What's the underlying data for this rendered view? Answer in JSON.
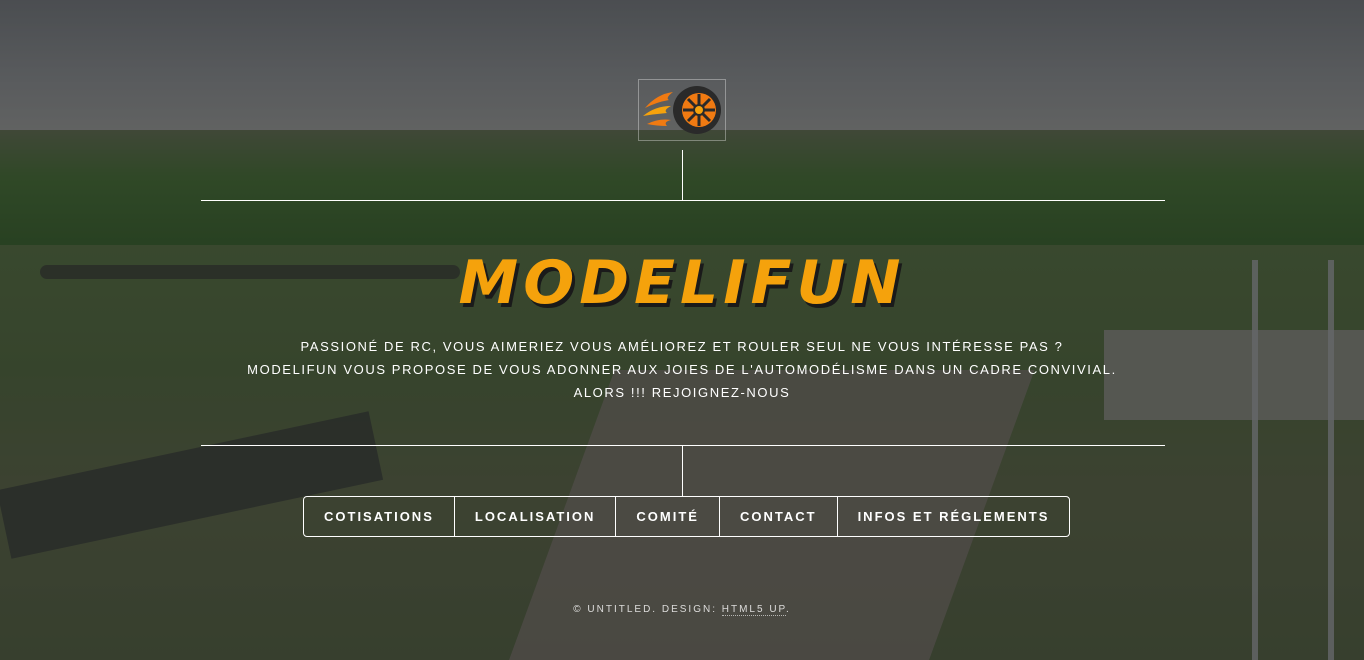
{
  "header": {
    "logo": "flaming-wheel-logo"
  },
  "main": {
    "title": "MODELIFUN",
    "tagline": [
      "Passioné de RC, vous aimeriez vous améliorez et rouler seul ne vous intéresse pas ?",
      "Modelifun vous propose de vous adonner aux joies de l'automodélisme dans un cadre convivial.",
      "Alors !!! Rejoignez-nous"
    ]
  },
  "nav": {
    "items": [
      {
        "label": "Cotisations"
      },
      {
        "label": "Localisation"
      },
      {
        "label": "Comité"
      },
      {
        "label": "Contact"
      },
      {
        "label": "Infos et Réglements"
      }
    ]
  },
  "footer": {
    "copyright": "© Untitled. Design:",
    "link_label": "HTML5 UP",
    "suffix": "."
  },
  "colors": {
    "title": "#f5a20c",
    "text": "#ffffff",
    "logo_flame": "#f07a12",
    "logo_wheel": "#2a2a2a"
  }
}
